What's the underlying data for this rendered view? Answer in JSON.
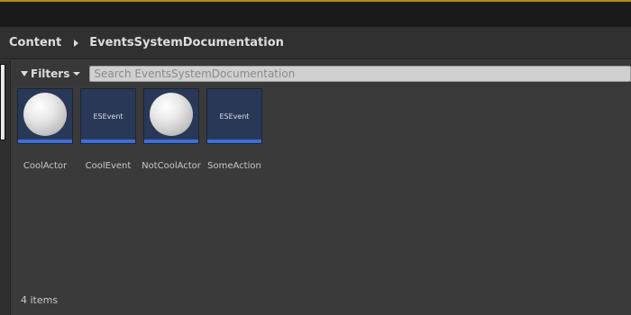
{
  "breadcrumb": {
    "root": "Content",
    "current": "EventsSystemDocumentation"
  },
  "toolbar": {
    "filters_label": "Filters",
    "search_placeholder": "Search EventsSystemDocumentation",
    "search_value": ""
  },
  "assets": [
    {
      "name": "CoolActor",
      "thumbnail": "sphere",
      "type_label": ""
    },
    {
      "name": "CoolEvent",
      "thumbnail": "label",
      "type_label": "ESEvent"
    },
    {
      "name": "NotCoolActor",
      "thumbnail": "sphere",
      "type_label": ""
    },
    {
      "name": "SomeAction",
      "thumbnail": "label",
      "type_label": "ESEvent"
    }
  ],
  "status": {
    "item_count": "4 items"
  },
  "colors": {
    "accent_top": "#b08a18",
    "asset_bar": "#3e6fd8",
    "thumb_bg": "#2a3857"
  }
}
